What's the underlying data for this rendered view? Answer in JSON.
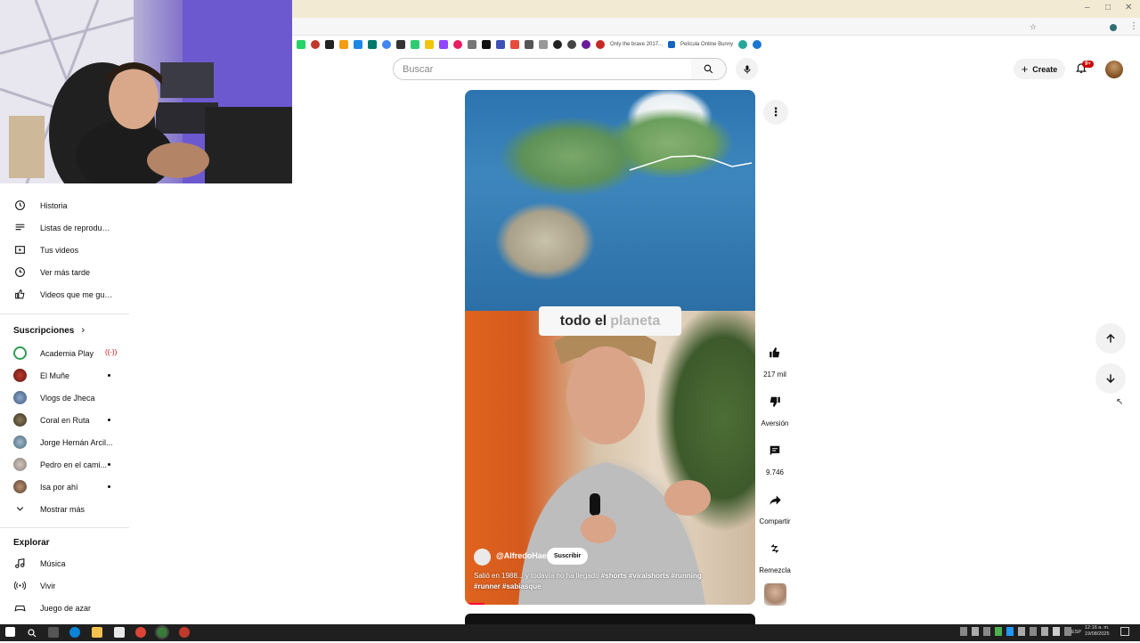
{
  "colors": {
    "brand_red": "#ff0033",
    "chip_bg": "#f2f2f2",
    "text": "#0f0f0f",
    "taskbar": "#1f1f1f"
  },
  "browser": {
    "bookmark_1": "Only the brave 2017...",
    "bookmark_2": "Película Online Bunny"
  },
  "header": {
    "search_placeholder": "Buscar",
    "create_label": "Create",
    "notification_badge": "9+"
  },
  "sidebar": {
    "you_items": [
      {
        "label": "Historia",
        "icon": "history-icon"
      },
      {
        "label": "Listas de reproducc...",
        "icon": "playlist-icon"
      },
      {
        "label": "Tus videos",
        "icon": "your-videos-icon"
      },
      {
        "label": "Ver más tarde",
        "icon": "watch-later-icon"
      },
      {
        "label": "Videos que me gus...",
        "icon": "thumbs-up-icon"
      }
    ],
    "subscriptions_title": "Suscripciones",
    "subscriptions": [
      {
        "label": "Academia Play",
        "indicator": "live"
      },
      {
        "label": "El Muñe",
        "indicator": "dot"
      },
      {
        "label": "Vlogs de Jheca",
        "indicator": ""
      },
      {
        "label": "Coral en Ruta",
        "indicator": "dot"
      },
      {
        "label": "Jorge Hernán Arcil...",
        "indicator": ""
      },
      {
        "label": "Pedro en el cami...",
        "indicator": "dot"
      },
      {
        "label": "Isa por ahí",
        "indicator": "dot"
      }
    ],
    "show_more": "Mostrar más",
    "explore_title": "Explorar",
    "explore": [
      {
        "label": "Música",
        "icon": "music-icon"
      },
      {
        "label": "Vivir",
        "icon": "live-icon"
      },
      {
        "label": "Juego de azar",
        "icon": "gaming-icon"
      }
    ]
  },
  "short": {
    "caption_word_1": "todo el",
    "caption_word_2": "planeta",
    "channel": "@AlfredoHae",
    "subscribe": "Suscribir",
    "description_plain": "Salió en 1988... y todavía no ha llegado",
    "hashtags_line1": "#shorts #viralshorts #running",
    "hashtags_line2": "#runner #sabiasque",
    "progress_fraction": 0.07
  },
  "actions": {
    "likes": "217 mil",
    "dislike": "Aversión",
    "comments": "9.746",
    "share": "Compartir",
    "remix": "Remezcla"
  },
  "taskbar": {
    "lang": "ESP",
    "time": "12:16 a. m.",
    "date": "19/08/2025"
  }
}
